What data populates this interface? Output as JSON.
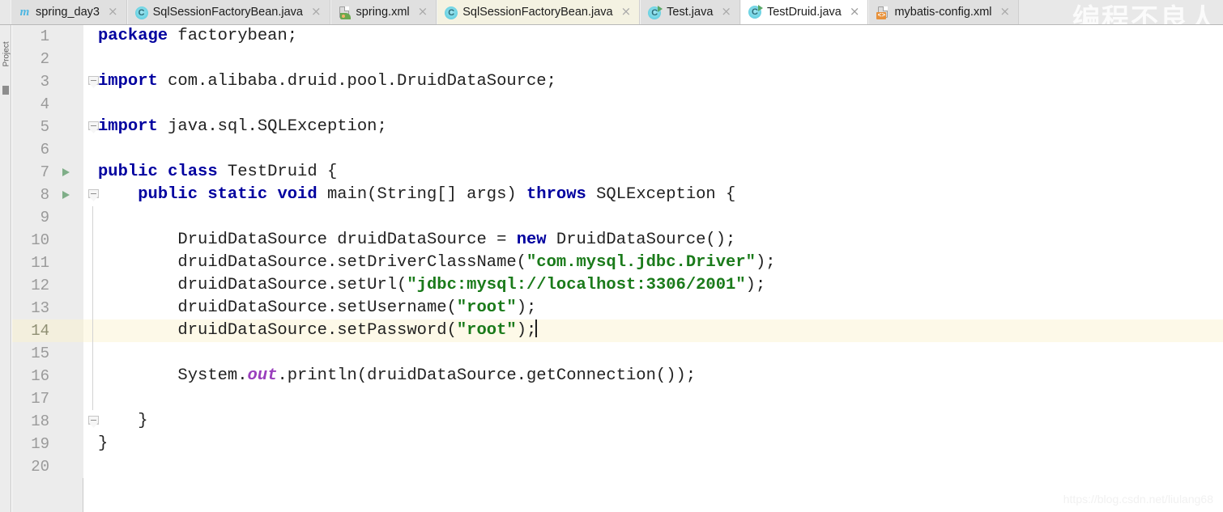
{
  "window": {
    "tool_strip_label": "Project",
    "watermark_top": "编程不良人",
    "watermark_bottom": "https://blog.csdn.net/liulang68"
  },
  "tabs": [
    {
      "label": "spring_day3",
      "icon": "maven-icon",
      "state": "shaded",
      "close": "×"
    },
    {
      "label": "SqlSessionFactoryBean.java",
      "icon": "java-class-icon",
      "state": "shaded",
      "close": "×"
    },
    {
      "label": "spring.xml",
      "icon": "spring-xml-icon",
      "state": "shaded",
      "close": "×"
    },
    {
      "label": "SqlSessionFactoryBean.java",
      "icon": "java-class-icon",
      "state": "yellowish",
      "close": "×"
    },
    {
      "label": "Test.java",
      "icon": "java-run-icon",
      "state": "shaded",
      "close": "×"
    },
    {
      "label": "TestDruid.java",
      "icon": "java-run-icon",
      "state": "active",
      "close": "×"
    },
    {
      "label": "mybatis-config.xml",
      "icon": "xml-icon",
      "state": "shaded",
      "close": "×"
    }
  ],
  "icon_glyphs": {
    "maven": "m",
    "class": "C",
    "xml_badge": "<>"
  },
  "editor": {
    "current_line": 14,
    "caret_line": 14,
    "total_lines": 20,
    "colors": {
      "keyword": "#00009f",
      "string": "#1a7a1a",
      "static_field": "#9a3fbd",
      "text": "#222222",
      "current_line_bg": "#fdf9e8",
      "gutter_bg": "#ececec"
    },
    "lines": [
      {
        "n": "1",
        "run": false,
        "fold": "none",
        "tokens": [
          {
            "t": "kw",
            "v": "package"
          },
          {
            "t": "pl",
            "v": " factorybean;"
          }
        ]
      },
      {
        "n": "2",
        "run": false,
        "fold": "none",
        "tokens": []
      },
      {
        "n": "3",
        "run": false,
        "fold": "mark",
        "tokens": [
          {
            "t": "kw",
            "v": "import"
          },
          {
            "t": "pl",
            "v": " com.alibaba.druid.pool.DruidDataSource;"
          }
        ]
      },
      {
        "n": "4",
        "run": false,
        "fold": "none",
        "tokens": []
      },
      {
        "n": "5",
        "run": false,
        "fold": "mark",
        "tokens": [
          {
            "t": "kw",
            "v": "import"
          },
          {
            "t": "pl",
            "v": " java.sql.SQLException;"
          }
        ]
      },
      {
        "n": "6",
        "run": false,
        "fold": "none",
        "tokens": []
      },
      {
        "n": "7",
        "run": true,
        "fold": "none",
        "tokens": [
          {
            "t": "kw",
            "v": "public class"
          },
          {
            "t": "pl",
            "v": " TestDruid {"
          }
        ]
      },
      {
        "n": "8",
        "run": true,
        "fold": "mark",
        "tokens": [
          {
            "t": "pl",
            "v": "    "
          },
          {
            "t": "kw",
            "v": "public static void"
          },
          {
            "t": "pl",
            "v": " main(String[] args) "
          },
          {
            "t": "kw",
            "v": "throws"
          },
          {
            "t": "pl",
            "v": " SQLException {"
          }
        ]
      },
      {
        "n": "9",
        "run": false,
        "fold": "line",
        "tokens": []
      },
      {
        "n": "10",
        "run": false,
        "fold": "line",
        "tokens": [
          {
            "t": "pl",
            "v": "        DruidDataSource druidDataSource = "
          },
          {
            "t": "kw",
            "v": "new"
          },
          {
            "t": "pl",
            "v": " DruidDataSource();"
          }
        ]
      },
      {
        "n": "11",
        "run": false,
        "fold": "line",
        "tokens": [
          {
            "t": "pl",
            "v": "        druidDataSource.setDriverClassName("
          },
          {
            "t": "str",
            "v": "\"com.mysql.jdbc.Driver\""
          },
          {
            "t": "pl",
            "v": ");"
          }
        ]
      },
      {
        "n": "12",
        "run": false,
        "fold": "line",
        "tokens": [
          {
            "t": "pl",
            "v": "        druidDataSource.setUrl("
          },
          {
            "t": "str",
            "v": "\"jdbc:mysql://localhost:3306/2001\""
          },
          {
            "t": "pl",
            "v": ");"
          }
        ]
      },
      {
        "n": "13",
        "run": false,
        "fold": "line",
        "tokens": [
          {
            "t": "pl",
            "v": "        druidDataSource.setUsername("
          },
          {
            "t": "str",
            "v": "\"root\""
          },
          {
            "t": "pl",
            "v": ");"
          }
        ]
      },
      {
        "n": "14",
        "run": false,
        "fold": "line",
        "tokens": [
          {
            "t": "pl",
            "v": "        druidDataSource.setPassword("
          },
          {
            "t": "str",
            "v": "\"root\""
          },
          {
            "t": "pl",
            "v": ");"
          },
          {
            "t": "caret",
            "v": ""
          }
        ]
      },
      {
        "n": "15",
        "run": false,
        "fold": "line",
        "tokens": []
      },
      {
        "n": "16",
        "run": false,
        "fold": "line",
        "tokens": [
          {
            "t": "pl",
            "v": "        System."
          },
          {
            "t": "stat",
            "v": "out"
          },
          {
            "t": "pl",
            "v": ".println(druidDataSource.getConnection());"
          }
        ]
      },
      {
        "n": "17",
        "run": false,
        "fold": "line",
        "tokens": []
      },
      {
        "n": "18",
        "run": false,
        "fold": "mark",
        "tokens": [
          {
            "t": "pl",
            "v": "    }"
          }
        ]
      },
      {
        "n": "19",
        "run": false,
        "fold": "none",
        "tokens": [
          {
            "t": "pl",
            "v": "}"
          }
        ]
      },
      {
        "n": "20",
        "run": false,
        "fold": "none",
        "tokens": []
      }
    ]
  }
}
